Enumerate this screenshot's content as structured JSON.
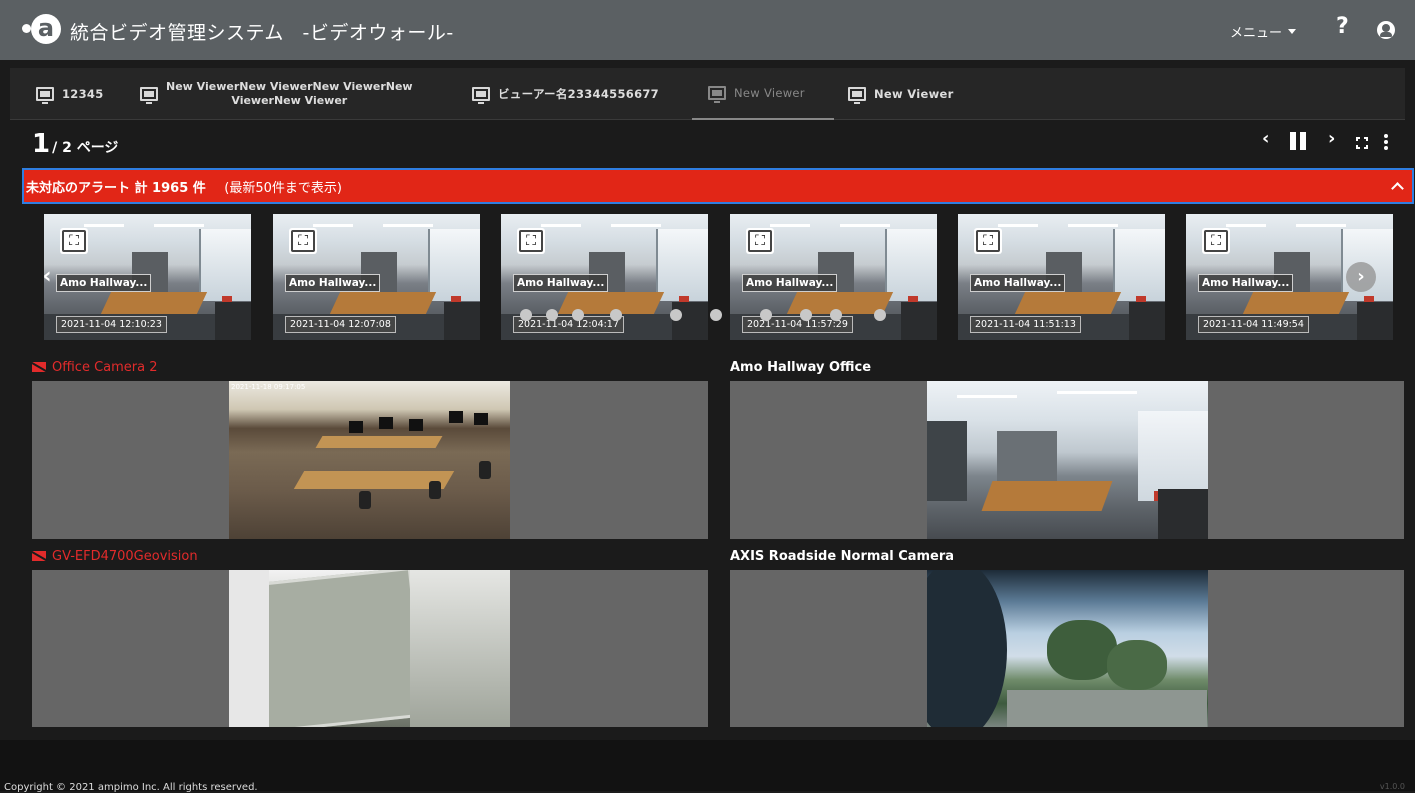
{
  "header": {
    "logo_glyph": "a",
    "title": "統合ビデオ管理システム",
    "subtitle": "-ビデオウォール-",
    "menu_label": "メニュー",
    "help_glyph": "?"
  },
  "tabs": [
    {
      "label": "12345"
    },
    {
      "label_line1": "New ViewerNew ViewerNew ViewerNew",
      "label_line2": "ViewerNew Viewer"
    },
    {
      "label": "ビューアー名23344556677"
    },
    {
      "label": "New Viewer",
      "active": true
    },
    {
      "label": "New Viewer"
    }
  ],
  "pagination": {
    "current": "1",
    "total_label": "/ 2 ページ"
  },
  "controls": {
    "prev": "‹",
    "next": "›"
  },
  "alert": {
    "text": "未対応のアラート 計 1965 件",
    "note": "(最新50件まで表示)",
    "bg_color": "#e12617",
    "border_color": "#2f7ee0"
  },
  "alert_thumbnails": [
    {
      "camera": "Amo Hallway...",
      "time": "2021-11-04 12:10:23"
    },
    {
      "camera": "Amo Hallway...",
      "time": "2021-11-04 12:07:08"
    },
    {
      "camera": "Amo Hallway...",
      "time": "2021-11-04 12:04:17"
    },
    {
      "camera": "Amo Hallway...",
      "time": "2021-11-04 11:57:29"
    },
    {
      "camera": "Amo Hallway...",
      "time": "2021-11-04 11:51:13"
    },
    {
      "camera": "Amo Hallway...",
      "time": "2021-11-04 11:49:54"
    }
  ],
  "carousel": {
    "left": "‹",
    "right": "›",
    "dot_count": 10
  },
  "cameras": [
    {
      "name": "Office Camera 2",
      "status": "error",
      "timestamp": "2021-11-18 09:17:05"
    },
    {
      "name": "Amo Hallway Office",
      "status": "ok"
    },
    {
      "name": "GV-EFD4700Geovision",
      "status": "error"
    },
    {
      "name": "AXIS Roadside Normal Camera",
      "status": "ok"
    }
  ],
  "footer": {
    "copyright": "Copyright © 2021 ampimo Inc. All rights reserved.",
    "version": "v1.0.0"
  }
}
